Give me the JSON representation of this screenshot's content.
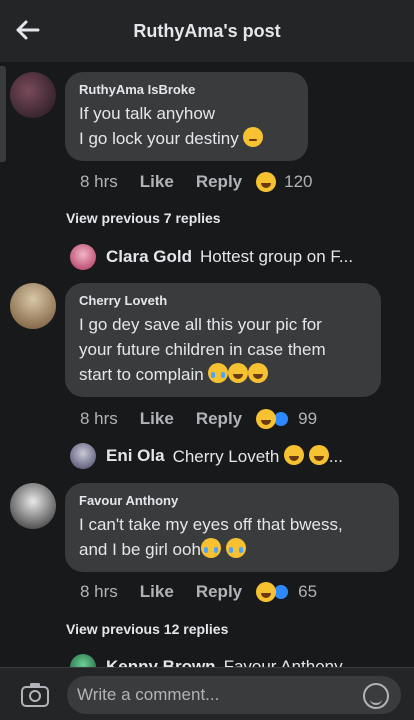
{
  "header": {
    "title": "RuthyAma's post"
  },
  "comments": [
    {
      "author": "RuthyAma IsBroke",
      "lines": [
        "If you talk anyhow",
        "I go lock your destiny"
      ],
      "time": "8 hrs",
      "like": "Like",
      "reply": "Reply",
      "reaction_count": "120"
    },
    {
      "author": "Cherry Loveth",
      "lines": [
        "I go dey save all this your pic for",
        "your future children in case them",
        "start to complain"
      ],
      "time": "8 hrs",
      "like": "Like",
      "reply": "Reply",
      "reaction_count": "99"
    },
    {
      "author": "Favour Anthony",
      "lines": [
        "I can't take my eyes off that bwess,",
        "and I be girl ooh"
      ],
      "time": "8 hrs",
      "like": "Like",
      "reply": "Reply",
      "reaction_count": "65"
    }
  ],
  "view_previous": [
    "View previous 7 replies",
    "View previous 12 replies"
  ],
  "reply_previews": [
    {
      "name": "Clara Gold",
      "text": "Hottest group on F..."
    },
    {
      "name": "Eni Ola",
      "text": "Cherry Loveth"
    },
    {
      "name": "Kenny Brown",
      "text": "Favour Anthony"
    }
  ],
  "footer": {
    "placeholder": "Write a comment..."
  },
  "colors": {
    "background": "#18191a",
    "bubble": "#3a3b3c",
    "header": "#242526",
    "muted": "#b0b3b8",
    "like_blue": "#2e89ff",
    "emoji": "#f7c232"
  }
}
